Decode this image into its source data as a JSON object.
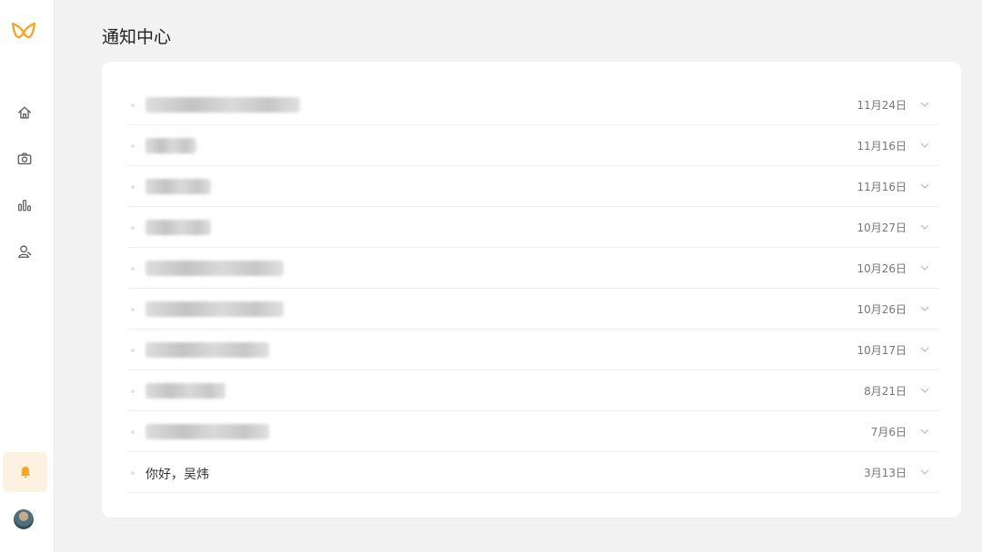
{
  "header": {
    "title": "通知中心"
  },
  "sidebar": {
    "items": [
      {
        "icon": "home-icon"
      },
      {
        "icon": "camera-icon"
      },
      {
        "icon": "bar-chart-icon"
      },
      {
        "icon": "user-icon"
      }
    ],
    "active_item": "bell-icon",
    "accent_color": "#f5a623",
    "active_bg_color": "#fdf2e2"
  },
  "notifications": [
    {
      "title": "",
      "title_obscured": true,
      "date": "11月24日"
    },
    {
      "title": "",
      "title_obscured": true,
      "date": "11月16日"
    },
    {
      "title": "",
      "title_obscured": true,
      "date": "11月16日"
    },
    {
      "title": "",
      "title_obscured": true,
      "date": "10月27日"
    },
    {
      "title": "",
      "title_obscured": true,
      "date": "10月26日"
    },
    {
      "title": "",
      "title_obscured": true,
      "date": "10月26日"
    },
    {
      "title": "",
      "title_obscured": true,
      "date": "10月17日"
    },
    {
      "title": "",
      "title_obscured": true,
      "date": "8月21日"
    },
    {
      "title": "",
      "title_obscured": true,
      "date": "7月6日"
    },
    {
      "title": "你好，吴炜",
      "title_obscured": false,
      "date": "3月13日"
    }
  ]
}
